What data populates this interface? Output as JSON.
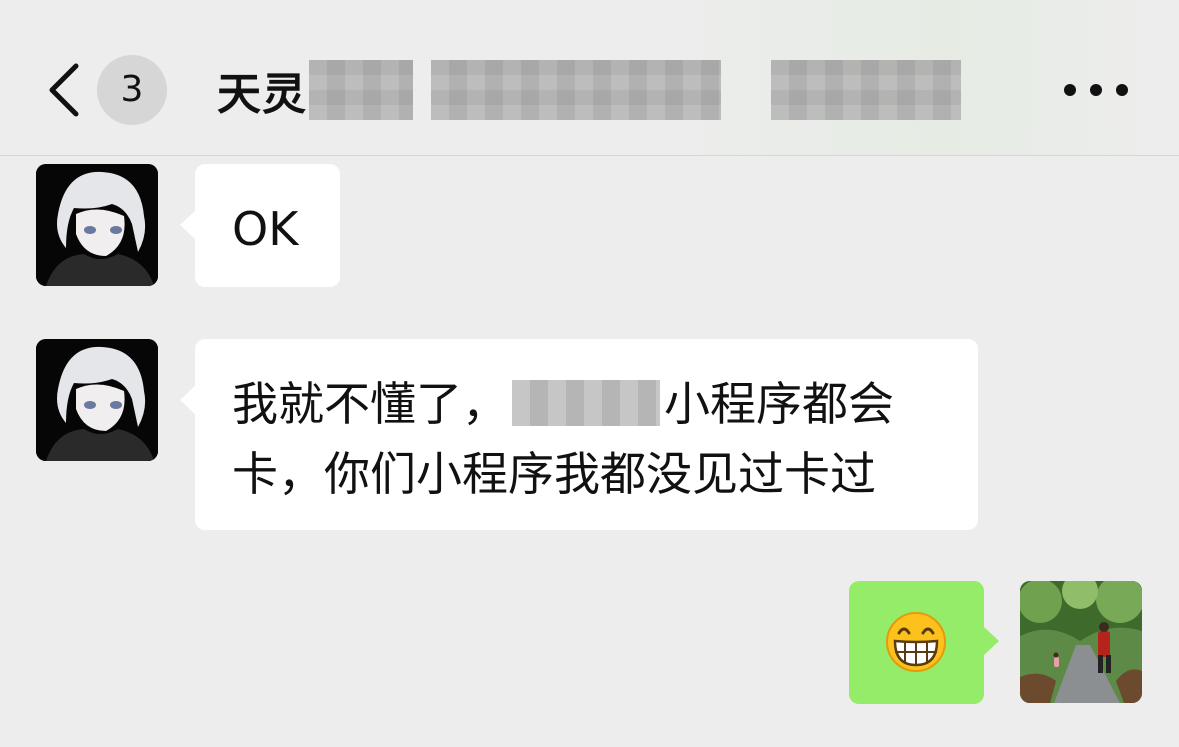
{
  "header": {
    "back_icon": "chevron-left-icon",
    "unread_count": "3",
    "chat_title": "天灵",
    "more_icon": "more-dots-icon"
  },
  "messages": [
    {
      "side": "left",
      "text": "OK"
    },
    {
      "side": "left",
      "text_part1": "我就不懂了，",
      "text_part2": "小程序都会",
      "text_line2": "卡，你们小程序我都没见过卡过"
    },
    {
      "side": "right",
      "emoji": "😁",
      "emoji_name": "grinning-face-icon"
    }
  ],
  "colors": {
    "background": "#ededed",
    "incoming_bubble": "#ffffff",
    "outgoing_bubble": "#95ec69",
    "badge": "#d6d6d6"
  }
}
